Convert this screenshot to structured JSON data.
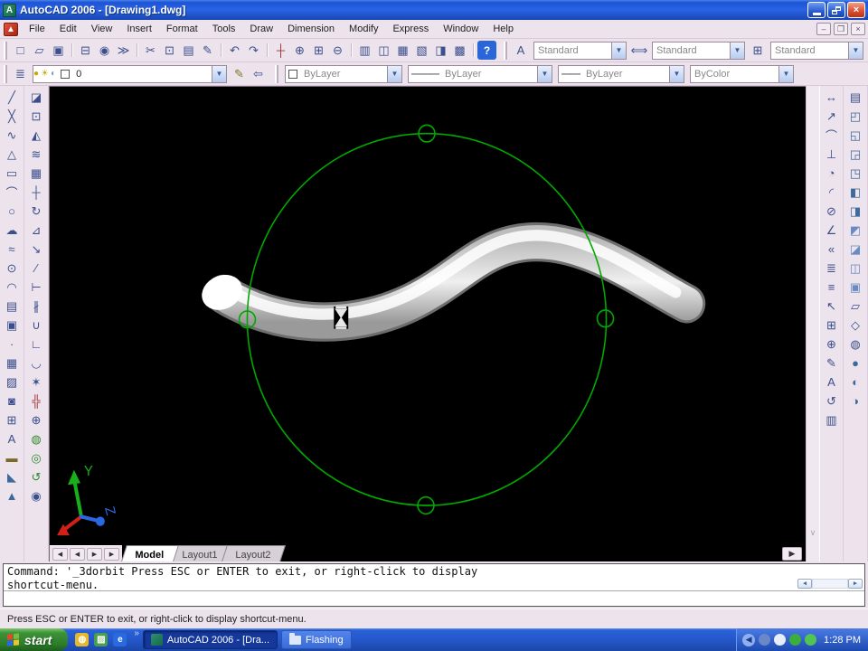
{
  "window": {
    "title": "AutoCAD 2006 - [Drawing1.dwg]",
    "app_icon_letter": "A"
  },
  "menu": {
    "items": [
      "File",
      "Edit",
      "View",
      "Insert",
      "Format",
      "Tools",
      "Draw",
      "Dimension",
      "Modify",
      "Express",
      "Window",
      "Help"
    ]
  },
  "toolbars": {
    "standard": [
      {
        "n": "new",
        "g": "□"
      },
      {
        "n": "open",
        "g": "▱"
      },
      {
        "n": "save",
        "g": "▣"
      },
      {
        "n": "plot",
        "g": "⊟",
        "sep": true
      },
      {
        "n": "plot-preview",
        "g": "◉"
      },
      {
        "n": "publish",
        "g": "≫"
      },
      {
        "n": "cut",
        "g": "✂",
        "sep": true
      },
      {
        "n": "copy-clip",
        "g": "⊡"
      },
      {
        "n": "paste",
        "g": "▤"
      },
      {
        "n": "match-properties",
        "g": "✎"
      },
      {
        "n": "undo",
        "g": "↶",
        "sep": true
      },
      {
        "n": "redo",
        "g": "↷"
      },
      {
        "n": "pan-realtime",
        "g": "┼",
        "sep": true,
        "c": "#a03030"
      },
      {
        "n": "zoom-realtime",
        "g": "⊕"
      },
      {
        "n": "zoom-window",
        "g": "⊞"
      },
      {
        "n": "zoom-previous",
        "g": "⊖"
      },
      {
        "n": "properties",
        "g": "▥",
        "sep": true
      },
      {
        "n": "designcenter",
        "g": "◫"
      },
      {
        "n": "tool-palettes",
        "g": "▦"
      },
      {
        "n": "sheet-set-manager",
        "g": "▧"
      },
      {
        "n": "markup-set-manager",
        "g": "◨"
      },
      {
        "n": "quickcalc",
        "g": "▩"
      }
    ],
    "help": {
      "n": "help",
      "g": "?"
    },
    "styles": [
      {
        "n": "text-style",
        "icon_g": "A",
        "value": "Standard"
      },
      {
        "n": "dim-style",
        "icon_g": "⟺",
        "value": "Standard"
      },
      {
        "n": "table-style",
        "icon_g": "⊞",
        "value": "Standard"
      }
    ],
    "layers": {
      "manager_icon": {
        "n": "layer-properties-manager",
        "g": "≣"
      },
      "combo": {
        "bulb": "●",
        "sun": "☀",
        "lock": "◐",
        "swatch_color": "#ffffff",
        "value": "0"
      },
      "buttons": [
        {
          "n": "make-object-layer-current",
          "g": "✎",
          "c": "#7a7a2a"
        },
        {
          "n": "layer-previous",
          "g": "⇦",
          "c": "#3c4f8c"
        }
      ]
    },
    "properties": {
      "color": {
        "label": "ByLayer",
        "swatch": "#ffffff"
      },
      "linetype": {
        "label": "ByLayer",
        "line": "———"
      },
      "lineweight": {
        "label": "ByLayer",
        "line": "——"
      },
      "plotstyle": {
        "label": "ByColor"
      }
    },
    "draw": [
      {
        "n": "line",
        "g": "╱"
      },
      {
        "n": "construction-line",
        "g": "╳"
      },
      {
        "n": "polyline",
        "g": "∿"
      },
      {
        "n": "polygon",
        "g": "△"
      },
      {
        "n": "rectangle",
        "g": "▭"
      },
      {
        "n": "arc",
        "g": "⌒"
      },
      {
        "n": "circle",
        "g": "○"
      },
      {
        "n": "revision-cloud",
        "g": "☁"
      },
      {
        "n": "spline",
        "g": "≈"
      },
      {
        "n": "ellipse",
        "g": "⊙"
      },
      {
        "n": "ellipse-arc",
        "g": "◠"
      },
      {
        "n": "insert-block",
        "g": "▤"
      },
      {
        "n": "make-block",
        "g": "▣"
      },
      {
        "n": "point",
        "g": "∙"
      },
      {
        "n": "hatch",
        "g": "▦"
      },
      {
        "n": "gradient",
        "g": "▨"
      },
      {
        "n": "region",
        "g": "◙"
      },
      {
        "n": "table",
        "g": "⊞"
      },
      {
        "n": "multiline-text",
        "g": "A"
      },
      {
        "n": "solids-box",
        "g": "▬",
        "c": "#7a6a2a"
      },
      {
        "n": "solids-wedge",
        "g": "◣",
        "c": "#3c6a9c"
      },
      {
        "n": "solids-cone",
        "g": "▲",
        "c": "#3c6a9c"
      }
    ],
    "modify": [
      {
        "n": "erase",
        "g": "◪"
      },
      {
        "n": "copy",
        "g": "⊡"
      },
      {
        "n": "mirror",
        "g": "◭"
      },
      {
        "n": "offset",
        "g": "≋"
      },
      {
        "n": "array",
        "g": "▦"
      },
      {
        "n": "move",
        "g": "┼"
      },
      {
        "n": "rotate",
        "g": "↻"
      },
      {
        "n": "scale",
        "g": "⊿"
      },
      {
        "n": "stretch",
        "g": "↘"
      },
      {
        "n": "trim",
        "g": "∕"
      },
      {
        "n": "extend",
        "g": "⊢"
      },
      {
        "n": "break",
        "g": "∦"
      },
      {
        "n": "join",
        "g": "∪"
      },
      {
        "n": "chamfer",
        "g": "∟"
      },
      {
        "n": "fillet",
        "g": "◡"
      },
      {
        "n": "explode",
        "g": "✶"
      },
      {
        "n": "pan",
        "g": "╬",
        "c": "#a03030"
      },
      {
        "n": "zoom",
        "g": "⊕"
      },
      {
        "n": "3d-orbit",
        "g": "◍",
        "c": "#2e8b2e"
      },
      {
        "n": "3d-continuous-orbit",
        "g": "◎",
        "c": "#2e8b2e"
      },
      {
        "n": "3d-swivel",
        "g": "↺",
        "c": "#2e8b2e"
      },
      {
        "n": "camera",
        "g": "◉"
      }
    ],
    "dimension": [
      {
        "n": "linear-dimension",
        "g": "↔"
      },
      {
        "n": "aligned-dimension",
        "g": "↗"
      },
      {
        "n": "arc-length-dimension",
        "g": "⌒"
      },
      {
        "n": "ordinate-dimension",
        "g": "⊥"
      },
      {
        "n": "radius-dimension",
        "g": "◔"
      },
      {
        "n": "jogged-dimension",
        "g": "◜"
      },
      {
        "n": "diameter-dimension",
        "g": "⊘"
      },
      {
        "n": "angular-dimension",
        "g": "∠"
      },
      {
        "n": "quick-dimension",
        "g": "«"
      },
      {
        "n": "baseline-dimension",
        "g": "≣"
      },
      {
        "n": "continue-dimension",
        "g": "≡"
      },
      {
        "n": "quick-leader",
        "g": "↖"
      },
      {
        "n": "tolerance",
        "g": "⊞"
      },
      {
        "n": "center-mark",
        "g": "⊕"
      },
      {
        "n": "dimension-edit",
        "g": "✎"
      },
      {
        "n": "dimension-text-edit",
        "g": "A"
      },
      {
        "n": "dimension-update",
        "g": "↺"
      },
      {
        "n": "dimension-style",
        "g": "▥"
      }
    ],
    "views": [
      {
        "n": "named-views",
        "g": "▤"
      },
      {
        "n": "top-view",
        "g": "◰",
        "c": "#3c6a9c"
      },
      {
        "n": "bottom-view",
        "g": "◱",
        "c": "#3c6a9c"
      },
      {
        "n": "left-view",
        "g": "◲",
        "c": "#3c6a9c"
      },
      {
        "n": "right-view",
        "g": "◳",
        "c": "#3c6a9c"
      },
      {
        "n": "front-view",
        "g": "◧",
        "c": "#3c6a9c"
      },
      {
        "n": "back-view",
        "g": "◨",
        "c": "#3c6a9c"
      },
      {
        "n": "sw-isometric-view",
        "g": "◩",
        "c": "#6a8ac4"
      },
      {
        "n": "se-isometric-view",
        "g": "◪",
        "c": "#6a8ac4"
      },
      {
        "n": "ne-isometric-view",
        "g": "◫",
        "c": "#6a8ac4"
      },
      {
        "n": "nw-isometric-view",
        "g": "▣",
        "c": "#6a8ac4"
      },
      {
        "n": "2d-wireframe",
        "g": "▱"
      },
      {
        "n": "3d-wireframe",
        "g": "◇"
      },
      {
        "n": "hidden-visual-style",
        "g": "◍"
      },
      {
        "n": "realistic-visual-style",
        "g": "●",
        "c": "#3c6a9c"
      },
      {
        "n": "conceptual-visual-style",
        "g": "◐",
        "c": "#3c6a9c"
      },
      {
        "n": "shaded",
        "g": "◑",
        "c": "#3c6a9c"
      }
    ]
  },
  "canvas": {
    "orbit_color": "#00a800",
    "ucs": {
      "y_label": "Y",
      "z_label": "Z"
    },
    "cursor": "hourglass-busy"
  },
  "tabs": {
    "nav": [
      {
        "n": "first-tab",
        "g": "◀"
      },
      {
        "n": "prev-tab",
        "g": "◀"
      },
      {
        "n": "next-tab",
        "g": "▶"
      },
      {
        "n": "last-tab",
        "g": "▶"
      }
    ],
    "items": [
      {
        "label": "Model",
        "active": true
      },
      {
        "label": "Layout1",
        "active": false
      },
      {
        "label": "Layout2",
        "active": false
      }
    ],
    "end_arrow": "▶"
  },
  "command": {
    "lines": [
      "Command: '_3dorbit Press ESC or ENTER to exit, or right-click to display",
      "shortcut-menu."
    ],
    "input": ""
  },
  "statusbar": {
    "message": "Press ESC or ENTER to exit, or right-click to display shortcut-menu."
  },
  "taskbar": {
    "start_label": "start",
    "quick_launch": [
      {
        "n": "browser-quicklaunch",
        "bg": "#e8b82c",
        "g": "◍"
      },
      {
        "n": "pictures-quicklaunch",
        "bg": "#4aa04a",
        "g": "▨"
      },
      {
        "n": "internet-explorer-quicklaunch",
        "bg": "#2a6ae0",
        "g": "e"
      }
    ],
    "overflow_chevron": "»",
    "tasks": [
      {
        "label": "AutoCAD 2006 - [Dra...",
        "active": true
      },
      {
        "label": "Flashing",
        "active": false
      }
    ],
    "tray_icons": [
      {
        "n": "tray-icon-network",
        "bg": "#6a88c8"
      },
      {
        "n": "tray-icon-document",
        "bg": "#e8eef8"
      },
      {
        "n": "tray-icon-utorrent",
        "bg": "#3cae3c"
      },
      {
        "n": "tray-icon-messenger",
        "bg": "#52c452"
      }
    ],
    "clock": "1:28 PM"
  }
}
